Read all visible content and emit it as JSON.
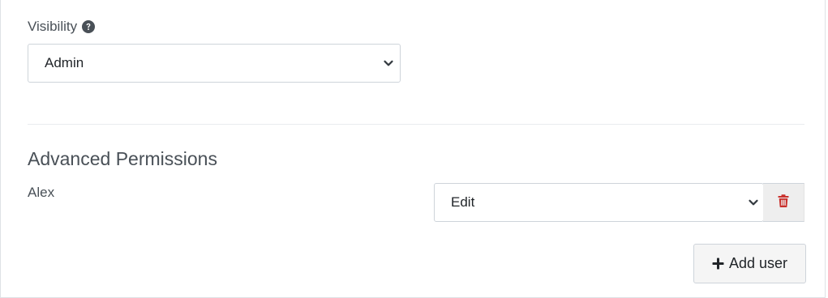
{
  "visibility": {
    "label": "Visibility",
    "help_icon": "question-circle-icon",
    "selected": "Admin"
  },
  "advanced_permissions": {
    "title": "Advanced Permissions",
    "users": [
      {
        "name": "Alex",
        "permission": "Edit",
        "delete_icon": "trash-icon"
      }
    ],
    "add_user_label": "Add user",
    "add_user_icon": "plus-icon"
  },
  "colors": {
    "delete_icon": "#c9302c",
    "text": "#495057"
  }
}
